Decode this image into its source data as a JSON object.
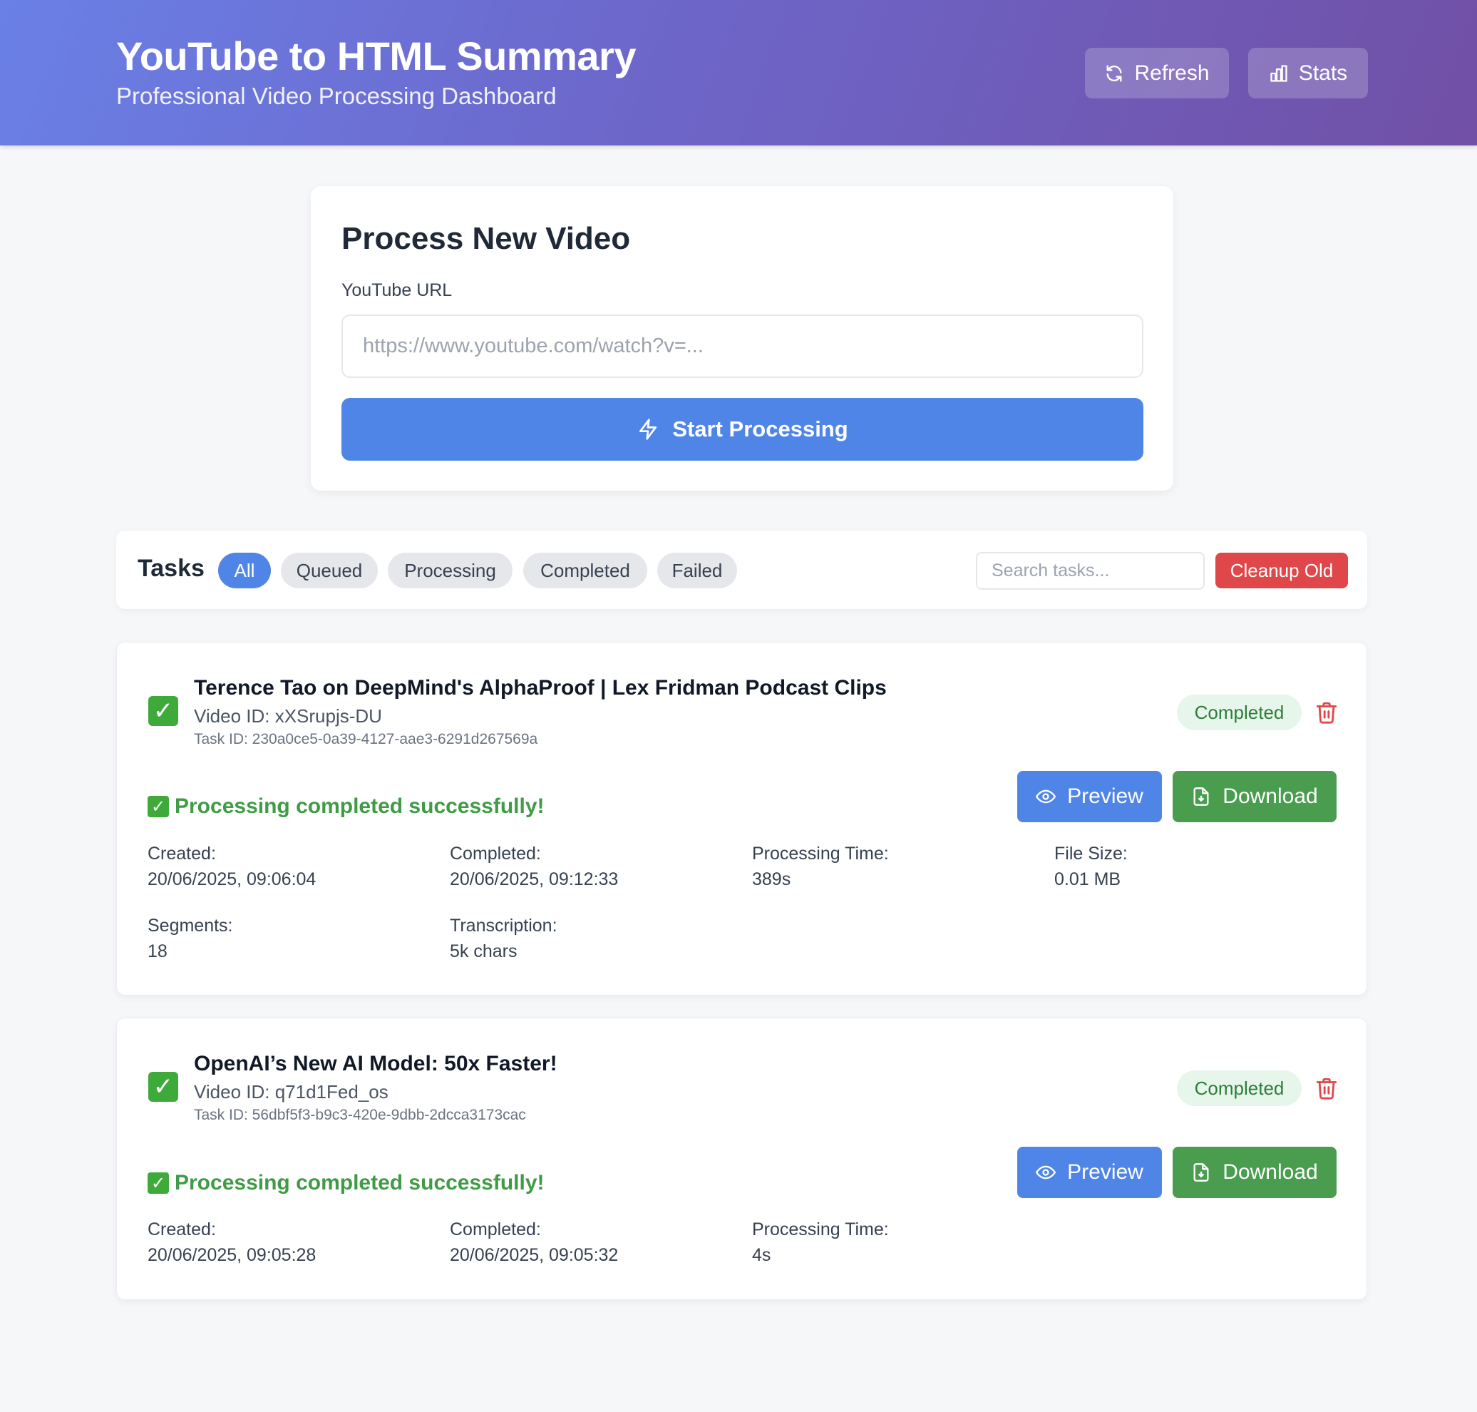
{
  "header": {
    "title": "YouTube to HTML Summary",
    "subtitle": "Professional Video Processing Dashboard",
    "refresh_label": "Refresh",
    "stats_label": "Stats"
  },
  "process": {
    "title": "Process New Video",
    "url_label": "YouTube URL",
    "url_placeholder": "https://www.youtube.com/watch?v=...",
    "url_value": "",
    "start_label": "Start Processing"
  },
  "tasks_bar": {
    "label": "Tasks",
    "filters": [
      "All",
      "Queued",
      "Processing",
      "Completed",
      "Failed"
    ],
    "active_filter": "All",
    "search_placeholder": "Search tasks...",
    "cleanup_label": "Cleanup Old"
  },
  "tasks": [
    {
      "title": "Terence Tao on DeepMind's AlphaProof | Lex Fridman Podcast Clips",
      "video_id": "Video ID: xXSrupjs-DU",
      "task_id": "Task ID: 230a0ce5-0a39-4127-aae3-6291d267569a",
      "status": "Completed",
      "message": "Processing completed successfully!",
      "preview_label": "Preview",
      "download_label": "Download",
      "meta": [
        {
          "label": "Created:",
          "value": "20/06/2025, 09:06:04"
        },
        {
          "label": "Completed:",
          "value": "20/06/2025, 09:12:33"
        },
        {
          "label": "Processing Time:",
          "value": "389s"
        },
        {
          "label": "File Size:",
          "value": "0.01 MB"
        },
        {
          "label": "Segments:",
          "value": "18"
        },
        {
          "label": "Transcription:",
          "value": "5k chars"
        }
      ]
    },
    {
      "title": "OpenAI’s New AI Model: 50x Faster!",
      "video_id": "Video ID: q71d1Fed_os",
      "task_id": "Task ID: 56dbf5f3-b9c3-420e-9dbb-2dcca3173cac",
      "status": "Completed",
      "message": "Processing completed successfully!",
      "preview_label": "Preview",
      "download_label": "Download",
      "meta": [
        {
          "label": "Created:",
          "value": "20/06/2025, 09:05:28"
        },
        {
          "label": "Completed:",
          "value": "20/06/2025, 09:05:32"
        },
        {
          "label": "Processing Time:",
          "value": "4s"
        }
      ]
    }
  ],
  "colors": {
    "accent": "#5085e8",
    "success": "#4a9d4f",
    "danger": "#e0474a",
    "header_start": "#6a80e6",
    "header_end": "#7150a6"
  },
  "icons": {
    "refresh": "refresh-icon",
    "stats": "bar-chart-icon",
    "start": "lightning-icon",
    "preview": "eye-icon",
    "download": "file-download-icon",
    "delete": "trash-icon",
    "done": "check-box-icon"
  }
}
